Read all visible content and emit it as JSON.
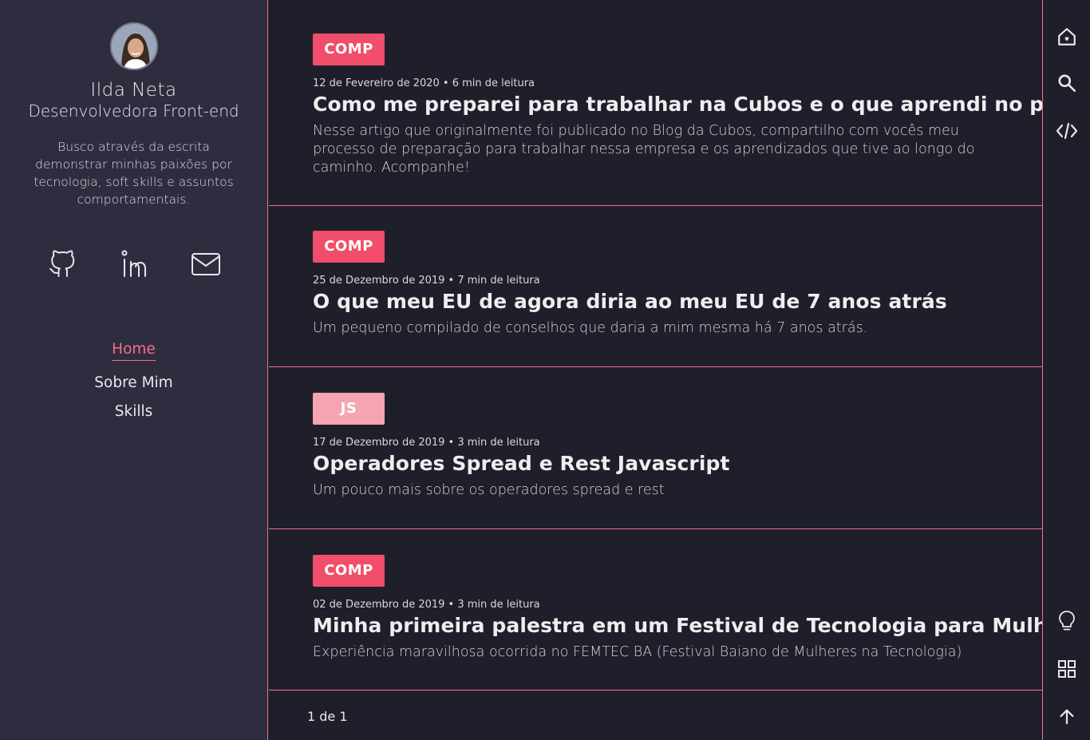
{
  "profile": {
    "name": "Ilda  Neta",
    "role": "Desenvolvedora  Front-end",
    "bio": "Busco através da escrita demonstrar minhas paixões por tecnologia, soft skills e assuntos comportamentais."
  },
  "socials": [
    {
      "icon": "github-icon"
    },
    {
      "icon": "linkedin-icon"
    },
    {
      "icon": "mail-icon"
    }
  ],
  "nav": {
    "home": "Home",
    "about": "Sobre  Mim",
    "skills": "Skills"
  },
  "posts": [
    {
      "tag": "COMP",
      "meta": "12 de Fevereiro de 2020 • 6 min de leitura",
      "title": "Como me preparei para trabalhar na Cubos e o que aprendi no processo",
      "description": "Nesse artigo que originalmente foi publicado no Blog da Cubos, compartilho com vocês meu processo de preparação para trabalhar nessa empresa e os aprendizados que tive ao longo do caminho. Acompanhe!"
    },
    {
      "tag": "COMP",
      "meta": "25 de Dezembro de 2019 • 7 min de leitura",
      "title": "O que meu EU de agora diria ao meu EU de 7 anos atrás",
      "description": "Um pequeno compilado de conselhos que daria a mim mesma há 7 anos atrás."
    },
    {
      "tag": "JS",
      "meta": "17 de Dezembro de 2019 • 3 min de leitura",
      "title": "Operadores Spread e Rest Javascript",
      "description": "Um pouco mais sobre os operadores spread e rest"
    },
    {
      "tag": "COMP",
      "meta": "02 de Dezembro de 2019 • 3 min de leitura",
      "title": "Minha primeira palestra em um Festival de Tecnologia para Mulheres",
      "description": "Experiência maravilhosa ocorrida no FEMTEC BA (Festival Baiano de Mulheres na Tecnologia)"
    }
  ],
  "pagination": "1 de 1",
  "rail": {
    "top": [
      "home-icon",
      "search-icon",
      "code-icon"
    ],
    "bottom": [
      "lightbulb-icon",
      "grid-icon",
      "arrow-up-icon"
    ]
  },
  "colors": {
    "accent": "#f2718a",
    "tag_comp": "#f04e6a",
    "tag_js": "#f6a4b0",
    "sidebar_bg": "#2e2d3f",
    "main_bg": "#1f1e2b"
  }
}
